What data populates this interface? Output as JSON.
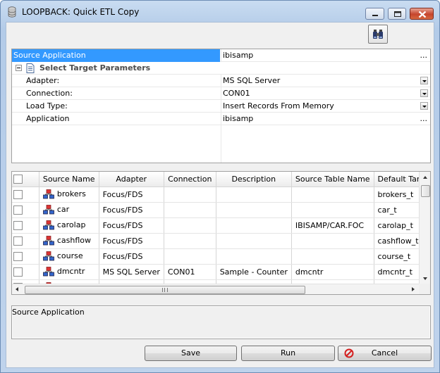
{
  "window": {
    "title": "LOOPBACK: Quick ETL Copy",
    "icon": "database-icon"
  },
  "toolbar": {
    "find_icon": "binoculars-icon"
  },
  "properties": {
    "rows": [
      {
        "name": "Source Application",
        "value": "ibisamp",
        "control": "ellipsis",
        "selected": true
      },
      {
        "name": "Select Target Parameters",
        "category": true
      },
      {
        "name": "Adapter:",
        "value": "MS SQL Server",
        "control": "dropdown"
      },
      {
        "name": "Connection:",
        "value": "CON01",
        "control": "dropdown"
      },
      {
        "name": "Load Type:",
        "value": "Insert Records From Memory",
        "control": "dropdown"
      },
      {
        "name": "Application",
        "value": "ibisamp",
        "control": "ellipsis"
      }
    ],
    "ellipsis": "..."
  },
  "grid": {
    "columns": [
      "",
      "Source Name",
      "Adapter",
      "Connection",
      "Description",
      "Source Table Name",
      "Default Targ"
    ],
    "rows": [
      {
        "source_name": "brokers",
        "adapter": "Focus/FDS",
        "connection": "",
        "description": "",
        "source_table": "",
        "default_target": "brokers_t"
      },
      {
        "source_name": "car",
        "adapter": "Focus/FDS",
        "connection": "",
        "description": "",
        "source_table": "",
        "default_target": "car_t"
      },
      {
        "source_name": "carolap",
        "adapter": "Focus/FDS",
        "connection": "",
        "description": "",
        "source_table": "IBISAMP/CAR.FOC",
        "default_target": "carolap_t"
      },
      {
        "source_name": "cashflow",
        "adapter": "Focus/FDS",
        "connection": "",
        "description": "",
        "source_table": "",
        "default_target": "cashflow_t"
      },
      {
        "source_name": "course",
        "adapter": "Focus/FDS",
        "connection": "",
        "description": "",
        "source_table": "",
        "default_target": "course_t"
      },
      {
        "source_name": "dmcntr",
        "adapter": "MS SQL Server",
        "connection": "CON01",
        "description": "Sample - Counter",
        "source_table": "dmcntr",
        "default_target": "dmcntr_t"
      }
    ]
  },
  "description_panel": {
    "text": "Source Application"
  },
  "buttons": {
    "save": "Save",
    "run": "Run",
    "cancel": "Cancel"
  }
}
